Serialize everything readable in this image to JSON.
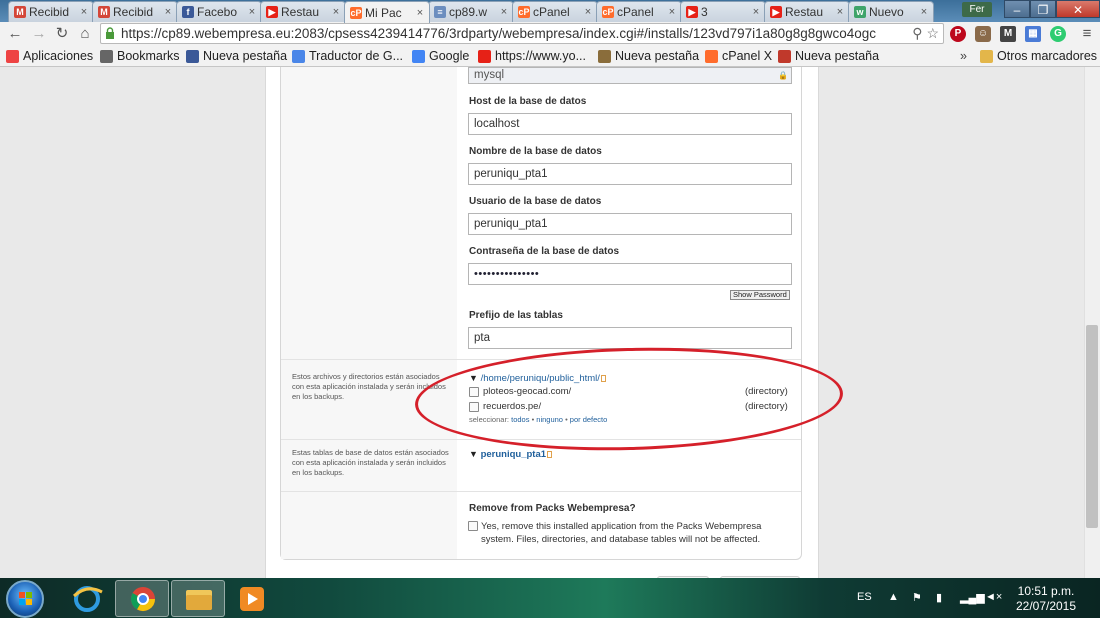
{
  "browser": {
    "tabs": [
      {
        "label": "Recibid",
        "fav": "M",
        "color": "#d44638"
      },
      {
        "label": "Recibid",
        "fav": "M",
        "color": "#d44638"
      },
      {
        "label": "Facebo",
        "fav": "f",
        "color": "#3b5998"
      },
      {
        "label": "Restau",
        "fav": "▶",
        "color": "#e62117"
      },
      {
        "label": "Mi Pac",
        "fav": "cP",
        "color": "#ff6c2c",
        "active": true
      },
      {
        "label": "cp89.w",
        "fav": "≡",
        "color": "#6c8ebf"
      },
      {
        "label": "cPanel",
        "fav": "cP",
        "color": "#ff6c2c"
      },
      {
        "label": "cPanel",
        "fav": "cP",
        "color": "#ff6c2c"
      },
      {
        "label": "3",
        "fav": "▶",
        "color": "#e62117"
      },
      {
        "label": "Restau",
        "fav": "▶",
        "color": "#e62117"
      },
      {
        "label": "Nuevo",
        "fav": "w",
        "color": "#3fa46a"
      }
    ],
    "tab_close": "×",
    "profile_label": "Fer",
    "url": "https://cp89.webempresa.eu:2083/cpsess4239414776/3rdparty/webempresa/index.cgi#/installs/123vd797i1a80g8g8gwco4ogc",
    "window_buttons": {
      "minimize": "–",
      "maximize": "❐",
      "close": "✕"
    }
  },
  "bookmarks": [
    {
      "label": "Aplicaciones",
      "color": "#e44"
    },
    {
      "label": "Bookmarks",
      "color": "#666"
    },
    {
      "label": "Nueva pestaña",
      "color": "#3b5998"
    },
    {
      "label": "Traductor de G...",
      "color": "#4a86e8"
    },
    {
      "label": "Google",
      "color": "#4285f4"
    },
    {
      "label": "https://www.yo...",
      "color": "#e62117"
    },
    {
      "label": "Nueva pestaña",
      "color": "#8a6d3b"
    },
    {
      "label": "cPanel X",
      "color": "#ff6c2c"
    },
    {
      "label": "Nueva pestaña",
      "color": "#c0392b"
    }
  ],
  "bookmarks_more": "»",
  "other_bookmarks": "Otros marcadores",
  "form": {
    "db_type_value": "mysql",
    "host_label": "Host de la base de datos",
    "host_value": "localhost",
    "dbname_label": "Nombre de la base de datos",
    "dbname_value": "peruniqu_pta1",
    "dbuser_label": "Usuario de la base de datos",
    "dbuser_value": "peruniqu_pta1",
    "dbpass_label": "Contraseña de la base de datos",
    "dbpass_value": "•••••••••••••••",
    "show_password": "Show Password",
    "prefix_label": "Prefijo de las tablas",
    "prefix_value": "pta"
  },
  "files_section": {
    "note": "Estos archivos y directorios están asociados con esta aplicación instalada y serán incluidos en los backups.",
    "root_path": "/home/peruniqu/public_html/",
    "items": [
      {
        "name": "ploteos-geocad.com/",
        "type": "(directory)"
      },
      {
        "name": "recuerdos.pe/",
        "type": "(directory)"
      }
    ],
    "select_prefix": "seleccionar:",
    "select_all": "todos",
    "select_none": "ninguno",
    "select_default": "por defecto"
  },
  "tables_section": {
    "note": "Estas tablas de base de datos están asociados con esta aplicación instalada y serán incluidos en los backups.",
    "db_name": "peruniqu_pta1"
  },
  "remove_section": {
    "title": "Remove from Packs Webempresa?",
    "checkbox_text": "Yes, remove this installed application from the Packs Webempresa system. Files, directories, and database tables will not be affected."
  },
  "taskbar": {
    "language": "ES",
    "time": "10:51 p.m.",
    "date": "22/07/2015"
  }
}
